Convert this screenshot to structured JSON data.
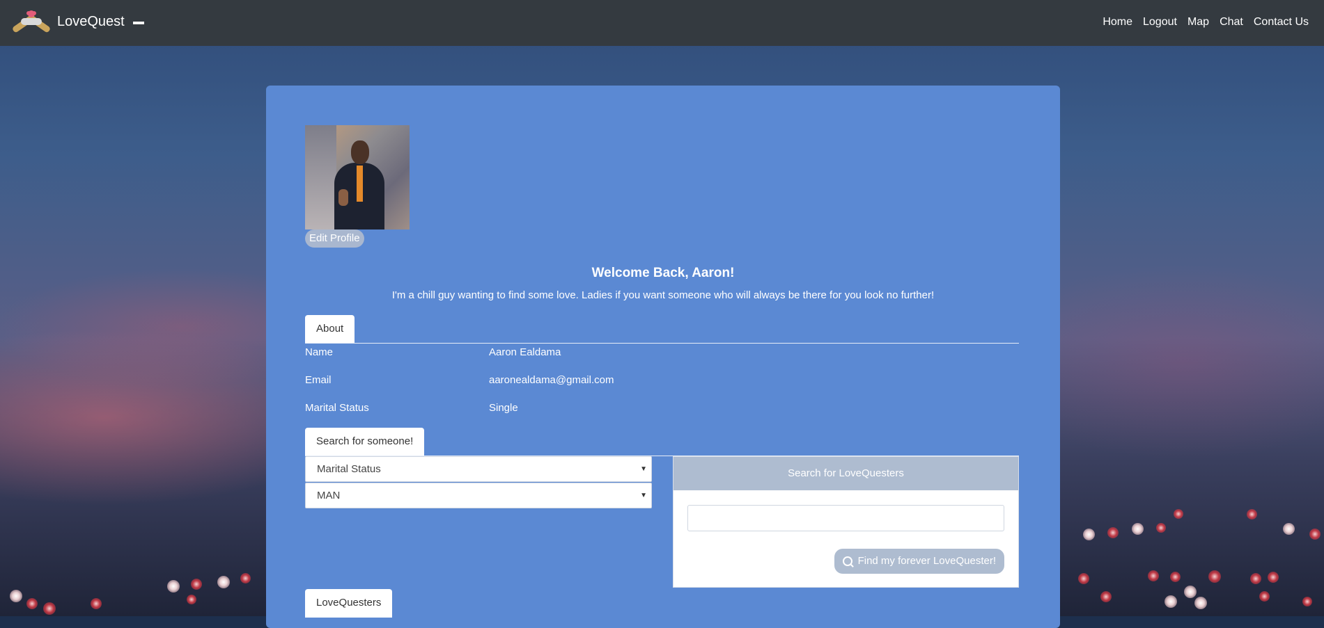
{
  "nav": {
    "brand": "LoveQuest",
    "links": [
      "Home",
      "Logout",
      "Map",
      "Chat",
      "Contact Us"
    ]
  },
  "profile": {
    "edit_button": "Edit Profile",
    "welcome": "Welcome Back, Aaron!",
    "bio": "I'm a chill guy wanting to find some love. Ladies if you want someone who will always be there for you look no further!"
  },
  "about": {
    "tab": "About",
    "rows": [
      {
        "label": "Name",
        "value": "Aaron Ealdama"
      },
      {
        "label": "Email",
        "value": "aaronealdama@gmail.com"
      },
      {
        "label": "Marital Status",
        "value": "Single"
      }
    ]
  },
  "search": {
    "tab": "Search for someone!",
    "marital_select": "Marital Status",
    "gender_select": "MAN",
    "panel_title": "Search for LoveQuesters",
    "input_value": "",
    "find_button": "Find my forever LoveQuester!"
  },
  "lovequesters": {
    "tab": "LoveQuesters"
  },
  "colors": {
    "navbar": "#343a40",
    "card": "#5b89d3",
    "panel_header": "#aebcd0"
  }
}
